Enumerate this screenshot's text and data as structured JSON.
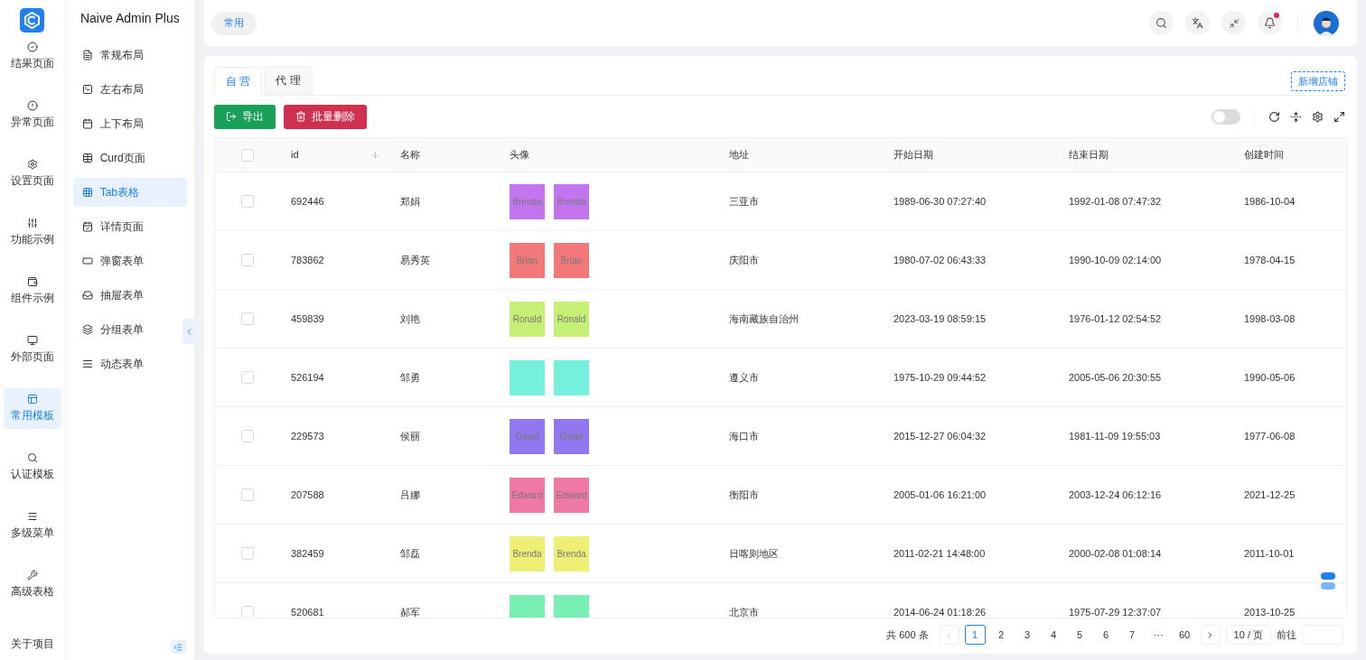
{
  "brand": {
    "title": "Naive Admin Plus"
  },
  "rail": [
    {
      "label": "结果页面",
      "selected": false
    },
    {
      "label": "异常页面",
      "selected": false
    },
    {
      "label": "设置页面",
      "selected": false
    },
    {
      "label": "功能示例",
      "selected": false
    },
    {
      "label": "组件示例",
      "selected": false
    },
    {
      "label": "外部页面",
      "selected": false
    },
    {
      "label": "常用模板",
      "selected": true
    },
    {
      "label": "认证模板",
      "selected": false
    },
    {
      "label": "多级菜单",
      "selected": false
    },
    {
      "label": "高级表格",
      "selected": false
    },
    {
      "label": "关于项目",
      "selected": false
    }
  ],
  "menu": [
    {
      "label": "常规布局",
      "selected": false
    },
    {
      "label": "左右布局",
      "selected": false
    },
    {
      "label": "上下布局",
      "selected": false
    },
    {
      "label": "Curd页面",
      "selected": false
    },
    {
      "label": "Tab表格",
      "selected": true
    },
    {
      "label": "详情页面",
      "selected": false
    },
    {
      "label": "弹窗表单",
      "selected": false
    },
    {
      "label": "抽屉表单",
      "selected": false
    },
    {
      "label": "分组表单",
      "selected": false
    },
    {
      "label": "动态表单",
      "selected": false
    }
  ],
  "header": {
    "quick_tab": "常用",
    "notifications_unread": true
  },
  "tabs": [
    {
      "label": "自 营",
      "selected": true
    },
    {
      "label": "代 理",
      "selected": false
    }
  ],
  "add_store_button": "新增店铺",
  "actions": [
    {
      "label": "导出",
      "kind": "export"
    },
    {
      "label": "批量删除",
      "kind": "delete"
    }
  ],
  "toggle": {
    "on": false
  },
  "table": {
    "all_checked": false,
    "columns": [
      "id",
      "名称",
      "头像",
      "地址",
      "开始日期",
      "结束日期",
      "创建时间"
    ],
    "rows": [
      {
        "checked": false,
        "id": "692446",
        "name": "郑娟",
        "avatars": [
          {
            "name": "Brenda",
            "color": "#c375f0"
          },
          {
            "name": "Brenda",
            "color": "#c375f0"
          }
        ],
        "address": "三亚市",
        "start": "1989-06-30 07:27:40",
        "end": "1992-01-08 07:47:32",
        "created": "1986-10-04"
      },
      {
        "checked": false,
        "id": "783862",
        "name": "易秀英",
        "avatars": [
          {
            "name": "Brian",
            "color": "#f2787a"
          },
          {
            "name": "Brian",
            "color": "#f2787a"
          }
        ],
        "address": "庆阳市",
        "start": "1980-07-02 06:43:33",
        "end": "1990-10-09 02:14:00",
        "created": "1978-04-15"
      },
      {
        "checked": false,
        "id": "459839",
        "name": "刘艳",
        "avatars": [
          {
            "name": "Ronald",
            "color": "#c5f075"
          },
          {
            "name": "Ronald",
            "color": "#c5f075"
          }
        ],
        "address": "海南藏族自治州",
        "start": "2023-03-19 08:59:15",
        "end": "1976-01-12 02:54:52",
        "created": "1998-03-08"
      },
      {
        "checked": false,
        "id": "526194",
        "name": "邹勇",
        "avatars": [
          {
            "color": "#75f0dc"
          },
          {
            "color": "#75f0dc"
          }
        ],
        "address": "遵义市",
        "start": "1975-10-29 09:44:52",
        "end": "2005-05-06 20:30:55",
        "created": "1990-05-06"
      },
      {
        "checked": false,
        "id": "229573",
        "name": "侯丽",
        "avatars": [
          {
            "name": "David",
            "color": "#9178f0"
          },
          {
            "name": "David",
            "color": "#9178f0"
          }
        ],
        "address": "海口市",
        "start": "2015-12-27 06:04:32",
        "end": "1981-11-09 19:55:03",
        "created": "1977-06-08"
      },
      {
        "checked": false,
        "id": "207588",
        "name": "吕娜",
        "avatars": [
          {
            "name": "Edward",
            "color": "#f078a5"
          },
          {
            "name": "Edward",
            "color": "#f078a5"
          }
        ],
        "address": "衡阳市",
        "start": "2005-01-06 16:21:00",
        "end": "2003-12-24 06:12:16",
        "created": "2021-12-25"
      },
      {
        "checked": false,
        "id": "382459",
        "name": "邹磊",
        "avatars": [
          {
            "name": "Brenda",
            "color": "#eef075"
          },
          {
            "name": "Brenda",
            "color": "#eef075"
          }
        ],
        "address": "日喀则地区",
        "start": "2011-02-21 14:48:00",
        "end": "2000-02-08 01:08:14",
        "created": "2011-10-01"
      },
      {
        "checked": false,
        "id": "520681",
        "name": "郝军",
        "avatars": [
          {
            "color": "#78f0b4"
          },
          {
            "color": "#78f0b4"
          }
        ],
        "address": "北京市",
        "start": "2014-06-24 01:18:26",
        "end": "1975-07-29 12:37:07",
        "created": "2013-10-25"
      }
    ]
  },
  "pagination": {
    "total": "共 600 条",
    "pages": [
      {
        "label": "1",
        "selected": true
      },
      {
        "label": "2",
        "selected": false
      },
      {
        "label": "3",
        "selected": false
      },
      {
        "label": "4",
        "selected": false
      },
      {
        "label": "5",
        "selected": false
      },
      {
        "label": "6",
        "selected": false
      },
      {
        "label": "7",
        "selected": false
      },
      {
        "label": "···",
        "selected": false
      },
      {
        "label": "60",
        "selected": false
      }
    ],
    "page_size": "10 / 页",
    "jump_label": "前往"
  }
}
